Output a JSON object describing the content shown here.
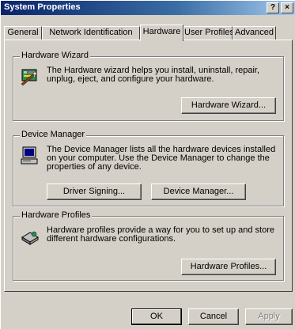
{
  "window": {
    "title": "System Properties",
    "help_button": "?",
    "close_button": "×"
  },
  "tabs": [
    {
      "label": "General"
    },
    {
      "label": "Network Identification"
    },
    {
      "label": "Hardware"
    },
    {
      "label": "User Profiles"
    },
    {
      "label": "Advanced"
    }
  ],
  "active_tab": "Hardware",
  "hardware_wizard": {
    "title": "Hardware Wizard",
    "description": "The Hardware wizard helps you install, uninstall, repair, unplug, eject, and configure your hardware.",
    "button": "Hardware Wizard..."
  },
  "device_manager": {
    "title": "Device Manager",
    "description": "The Device Manager lists all the hardware devices installed on your computer. Use the Device Manager to change the properties of any device.",
    "driver_signing_button": "Driver Signing...",
    "device_manager_button": "Device Manager..."
  },
  "hardware_profiles": {
    "title": "Hardware Profiles",
    "description": "Hardware profiles provide a way for you to set up and store different hardware configurations.",
    "button": "Hardware Profiles..."
  },
  "footer": {
    "ok": "OK",
    "cancel": "Cancel",
    "apply": "Apply"
  }
}
